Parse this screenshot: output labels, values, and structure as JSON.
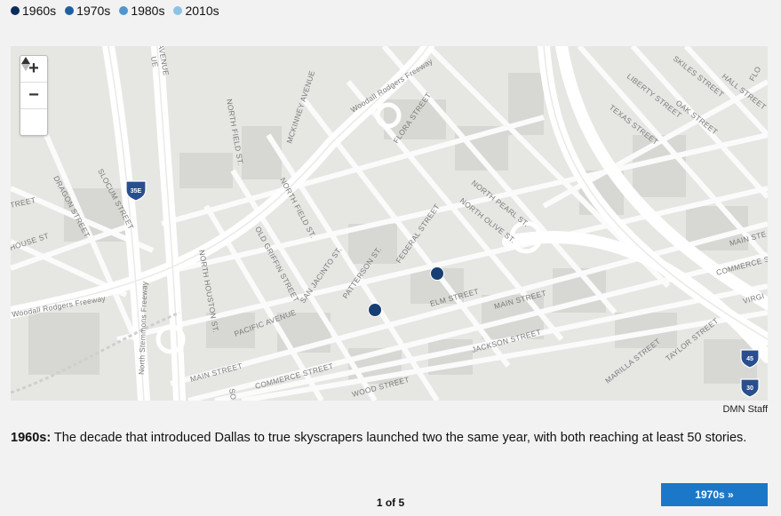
{
  "legend": [
    {
      "label": "1960s",
      "color": "#0d2c5b"
    },
    {
      "label": "1970s",
      "color": "#1e5fa0"
    },
    {
      "label": "1980s",
      "color": "#4f95cf"
    },
    {
      "label": "2010s",
      "color": "#8cc2e6"
    }
  ],
  "map": {
    "controls": {
      "zoom_in": "+",
      "zoom_out": "−",
      "reset": "▲"
    },
    "street_labels": {
      "woodall_rodgers_fwy_top": "Woodall Rodgers Freeway",
      "woodall_rodgers_fwy_left": "Woodall Rodgers Freeway",
      "north_stemmons_fwy": "North Stemmons Freeway",
      "north_houston": "NORTH HOUSTON ST.",
      "north_field_top": "NORTH FIELD ST.",
      "north_field": "NORTH FIELD ST.",
      "mckinney": "MCKINNEY AVENUE",
      "flora": "FLORA STREET",
      "north_pearl": "NORTH PEARL ST.",
      "north_olive": "NORTH OLIVE ST.",
      "federal": "FEDERAL STREET",
      "patterson": "PATTERSON ST.",
      "san_jacinto": "SAN JACINTO ST.",
      "old_griffin": "OLD GRIFFIN STREET",
      "pacific": "PACIFIC AVENUE",
      "elm": "ELM STREET",
      "main_center": "MAIN STREET",
      "main_left": "MAIN STREET",
      "main_right": "MAIN STE",
      "commerce_left": "COMMERCE STREET",
      "commerce_right": "COMMERCE S",
      "jackson": "JACKSON STREET",
      "wood": "WOOD STREET",
      "marilla": "MARILLA STREET",
      "taylor": "TAYLOR STREET",
      "liberty": "LIBERTY STREET",
      "texas": "TEXAS STREET",
      "oak": "OAK STREET",
      "hall": "HALL STREET",
      "skiles": "SKILES STREET",
      "dragon": "DRAGON STREET",
      "slocum": "SLOCUM STREET",
      "house": "HOUSE ST",
      "virgil": "VIRGI",
      "flo": "FLO",
      "ue": "UE",
      "ave": "AVENUE",
      "reet": "TREET",
      "so": "SO"
    },
    "shields": {
      "i35e": "35E",
      "i45": "45",
      "i30": "30"
    },
    "markers": [
      {
        "decade": "1960s",
        "lat": 32.7813,
        "lon": -96.7979
      },
      {
        "decade": "1960s",
        "lat": 32.7797,
        "lon": -96.8005
      }
    ]
  },
  "credit": "DMN Staff",
  "caption": {
    "lead": "1960s:",
    "text": " The decade that introduced Dallas to true skyscrapers launched two the same year, with both reaching at least 50 stories."
  },
  "pager": "1 of 5",
  "next_button": "1970s »"
}
